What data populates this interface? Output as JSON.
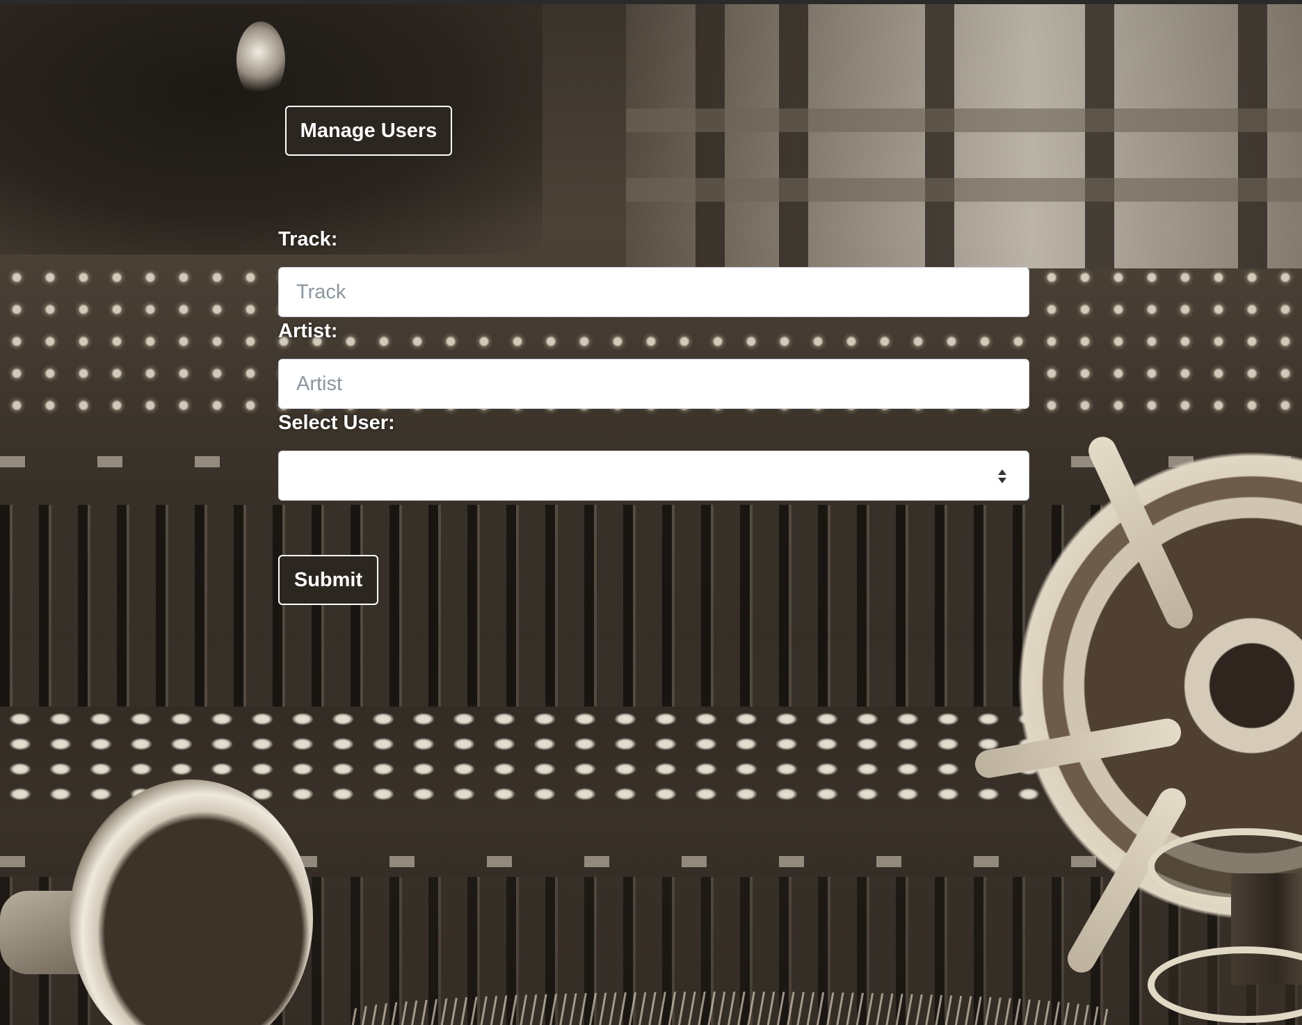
{
  "header": {
    "manage_users_label": "Manage Users"
  },
  "form": {
    "track": {
      "label": "Track:",
      "placeholder": "Track",
      "value": ""
    },
    "artist": {
      "label": "Artist:",
      "placeholder": "Artist",
      "value": ""
    },
    "user_select": {
      "label": "Select User:",
      "selected": ""
    },
    "submit_label": "Submit"
  },
  "colors": {
    "button_bg": "#2c2621",
    "button_border": "#ffffff",
    "placeholder_text": "#8c969e"
  },
  "icons": {
    "select_arrows": "select-arrows-icon"
  }
}
